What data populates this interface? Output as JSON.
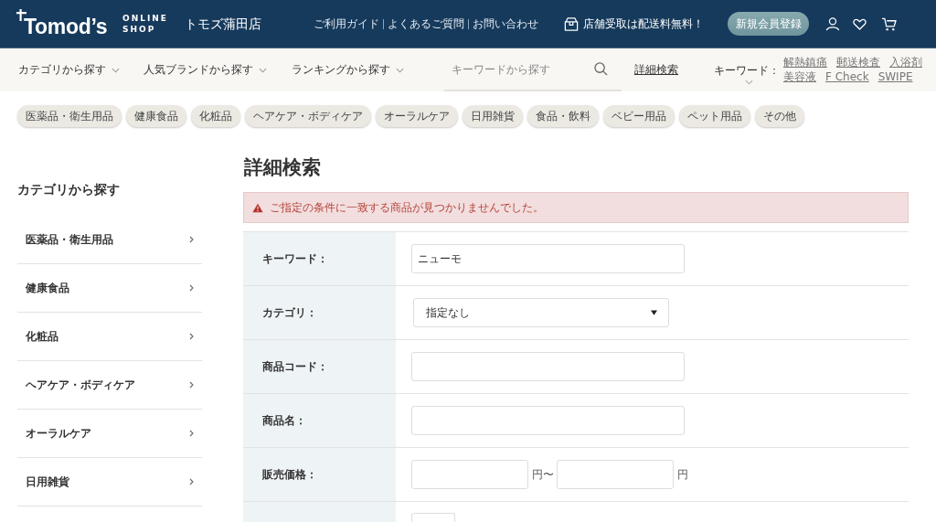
{
  "header": {
    "logo": {
      "wordmark": "Tomod’s",
      "tagline": [
        "ONLINE",
        "SHOP"
      ]
    },
    "store_name": "トモズ蒲田店",
    "links": [
      "ご利用ガイド",
      "よくあるご質問",
      "お問い合わせ"
    ],
    "promo": "店舗受取は配送料無料！",
    "register_button": "新規会員登録"
  },
  "nav": {
    "menus": [
      "カテゴリから探す",
      "人気ブランドから探す",
      "ランキングから探す"
    ],
    "search": {
      "placeholder": "キーワードから探す"
    },
    "advanced_search_link": "詳細検索",
    "keywords": {
      "label": "キーワード：",
      "links": [
        "解熱鎮痛",
        "郵送検査",
        "入浴剤",
        "美容液",
        "F Check",
        "SWIPE"
      ]
    }
  },
  "category_tags": [
    "医薬品・衛生用品",
    "健康食品",
    "化粧品",
    "ヘアケア・ボディケア",
    "オーラルケア",
    "日用雑貨",
    "食品・飲料",
    "ベビー用品",
    "ペット用品",
    "その他"
  ],
  "sidebar": {
    "title": "カテゴリから探す",
    "items": [
      "医薬品・衛生用品",
      "健康食品",
      "化粧品",
      "ヘアケア・ボディケア",
      "オーラルケア",
      "日用雑貨"
    ]
  },
  "main": {
    "title": "詳細検索",
    "alert": "ご指定の条件に一致する商品が見つかりませんでした。",
    "form": {
      "rows": [
        {
          "kind": "text",
          "label": "キーワード：",
          "value": "ニューモ"
        },
        {
          "kind": "select",
          "label": "カテゴリ：",
          "value": "指定なし"
        },
        {
          "kind": "text",
          "label": "商品コード："
        },
        {
          "kind": "text",
          "label": "商品名："
        },
        {
          "kind": "range",
          "label": "販売価格：",
          "from_unit": "円〜",
          "to_unit": "円"
        },
        {
          "kind": "short"
        }
      ]
    }
  }
}
